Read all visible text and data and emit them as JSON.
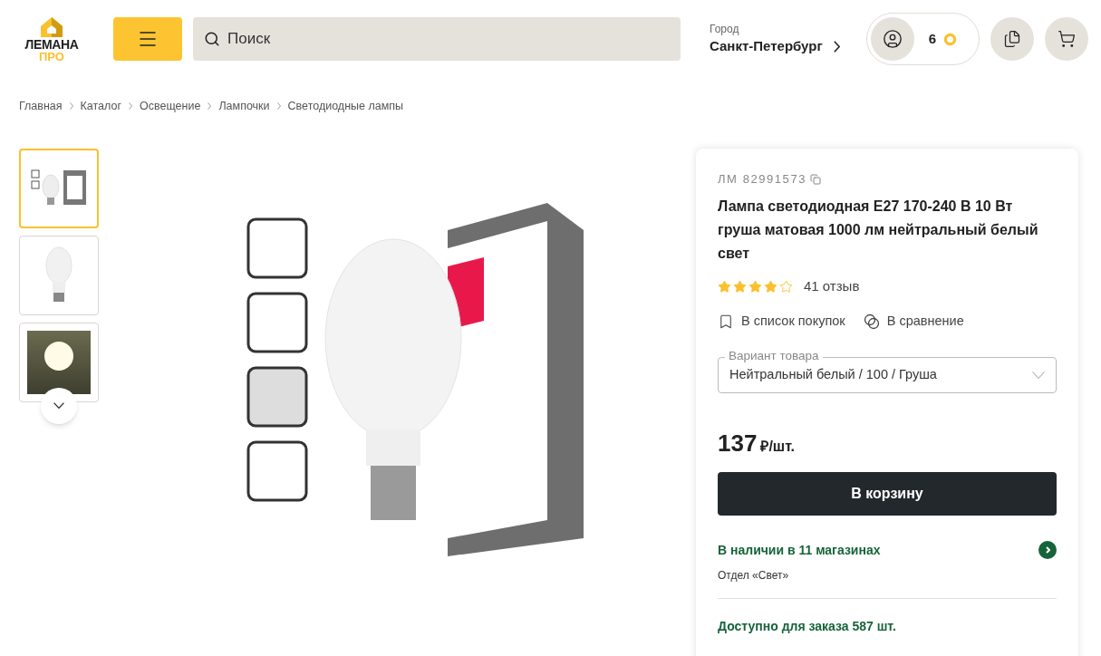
{
  "header": {
    "logo": {
      "line1": "ЛЕМАНА",
      "line2": "ПРО"
    },
    "search": {
      "placeholder": "Поиск"
    },
    "city": {
      "label": "Город",
      "value": "Санкт-Петербург"
    },
    "bonus_count": "6"
  },
  "breadcrumbs": [
    "Главная",
    "Каталог",
    "Освещение",
    "Лампочки",
    "Светодиодные лампы"
  ],
  "gallery": {
    "thumbnails": [
      {
        "kind": "package",
        "selected": true
      },
      {
        "kind": "bulb",
        "selected": false
      },
      {
        "kind": "lit",
        "selected": false
      }
    ]
  },
  "product": {
    "sku": "ЛМ 82991573",
    "title": "Лампа светодиодная E27 170-240 В 10 Вт груша матовая 1000 лм нейтральный белый свет",
    "stars": 4,
    "reviews": "41 отзыв",
    "actions": [
      "В список покупок",
      "В сравнение"
    ],
    "variant": {
      "label": "Вариант товара",
      "value": "Нейтральный белый / 100 / Груша"
    },
    "price": "137",
    "price_unit": "₽/шт.",
    "cart_button": "В корзину",
    "stock": "В наличии в 11 магазинах",
    "department": "Отдел «Свет»",
    "available": "Доступно для заказа 587 шт."
  }
}
